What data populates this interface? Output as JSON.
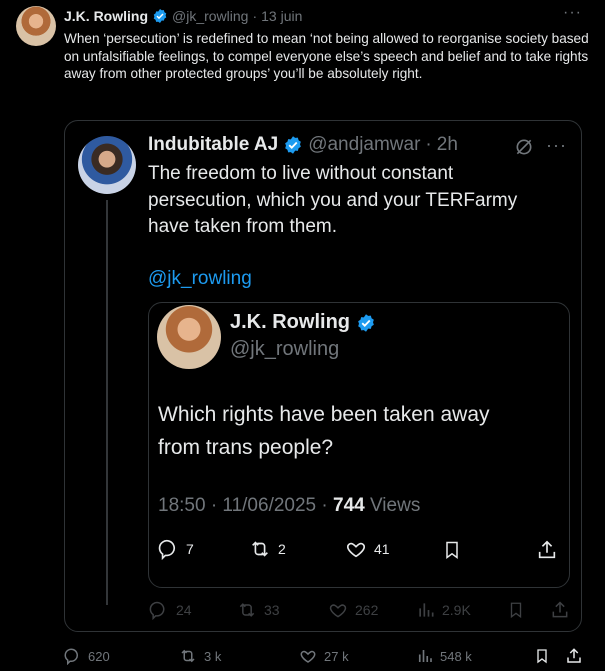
{
  "tweet": {
    "author": "J.K. Rowling",
    "handle": "@jk_rowling",
    "sep": "·",
    "date": "13 juin",
    "text": "When ‘persecution’ is redefined to mean ‘not being allowed to reorganise society based on unfalsifiable feelings, to compel everyone else’s speech and belief and to take rights away from other protected groups’ you’ll be absolutely right.",
    "more": "···",
    "actions": {
      "replies": "620",
      "reposts": "3 k",
      "likes": "27 k",
      "views": "548 k"
    }
  },
  "quote": {
    "author": "Indubitable AJ",
    "handle": "@andjamwar",
    "sep": "·",
    "time": "2h",
    "more": "···",
    "text": "The freedom to live without constant persecution, which you and your TERFarmy have taken from them.",
    "mention": "@jk_rowling",
    "actions": {
      "replies": "24",
      "reposts": "33",
      "likes": "262",
      "views": "2.9K"
    }
  },
  "inner": {
    "author": "J.K. Rowling",
    "handle": "@jk_rowling",
    "text_line1": "Which rights have been taken away",
    "text_line2": "from trans people?",
    "timestamp": "18:50 · 11/06/2025 · ",
    "views_count": "744",
    "views_label": " Views",
    "actions": {
      "replies": "7",
      "reposts": "2",
      "likes": "41"
    }
  },
  "colors": {
    "accent": "#1d9bf0",
    "muted": "#71767b",
    "text": "#e7e9ea",
    "border": "#2f3336",
    "bg": "#000000"
  },
  "icons": [
    "verified-badge-icon",
    "reply-icon",
    "repost-icon",
    "like-icon",
    "views-icon",
    "bookmark-icon",
    "share-icon",
    "more-icon",
    "grok-icon"
  ]
}
